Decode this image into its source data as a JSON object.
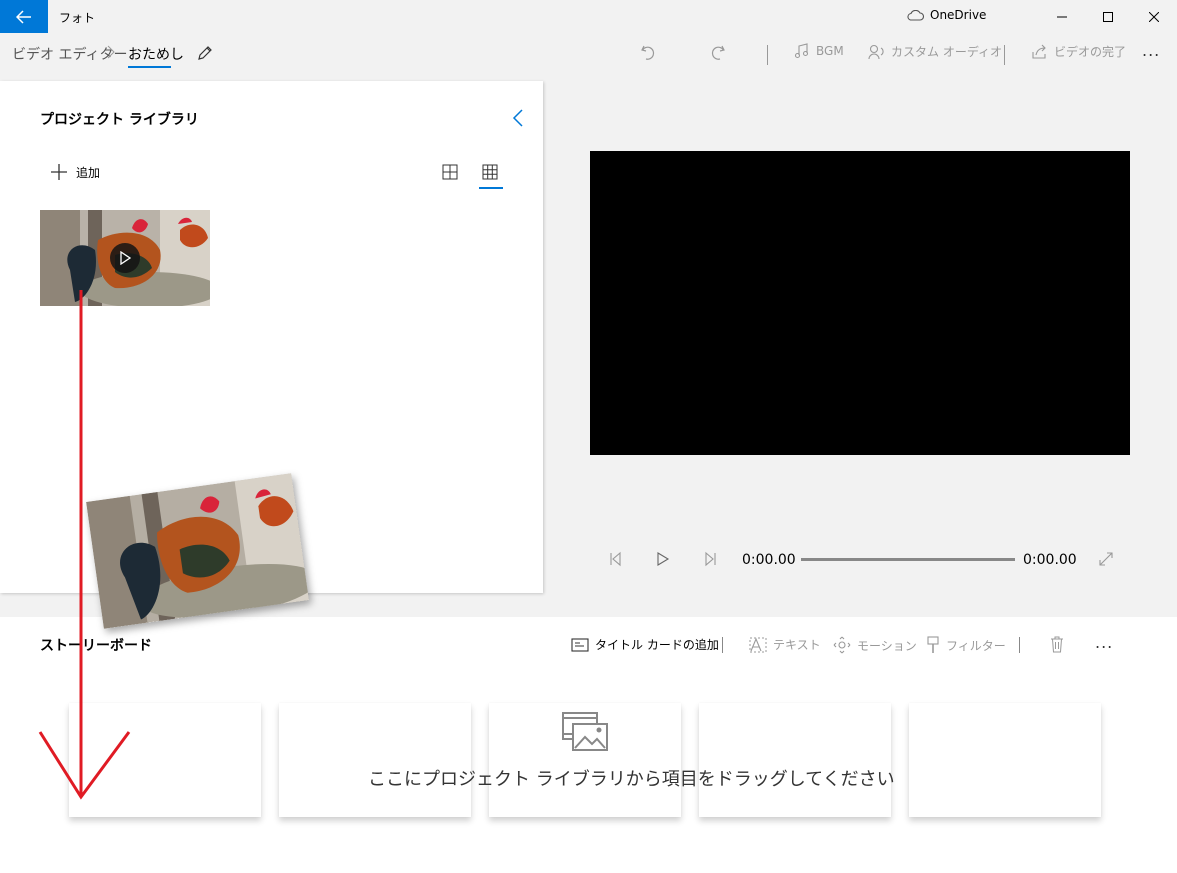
{
  "app": {
    "title": "フォト",
    "cloud_label": "OneDrive"
  },
  "breadcrumb": {
    "root": "ビデオ エディター",
    "current": "おためし"
  },
  "toolbar": {
    "bgm_label": "BGM",
    "custom_audio_label": "カスタム オーディオ",
    "finish_label": "ビデオの完了",
    "more_label": "..."
  },
  "library": {
    "title": "プロジェクト ライブラリ",
    "add_label": "追加"
  },
  "player": {
    "current_time": "0:00.00",
    "total_time": "0:00.00",
    "progress": 0
  },
  "storyboard": {
    "title": "ストーリーボード",
    "add_title_card_label": "タイトル カードの追加",
    "text_label": "テキスト",
    "motion_label": "モーション",
    "filter_label": "フィルター",
    "more_label": "...",
    "drop_hint": "ここにプロジェクト ライブラリから項目をドラッグしてください"
  },
  "colors": {
    "accent": "#0078d7",
    "annotation_arrow": "#e01b24",
    "preview_background": "#000000"
  }
}
